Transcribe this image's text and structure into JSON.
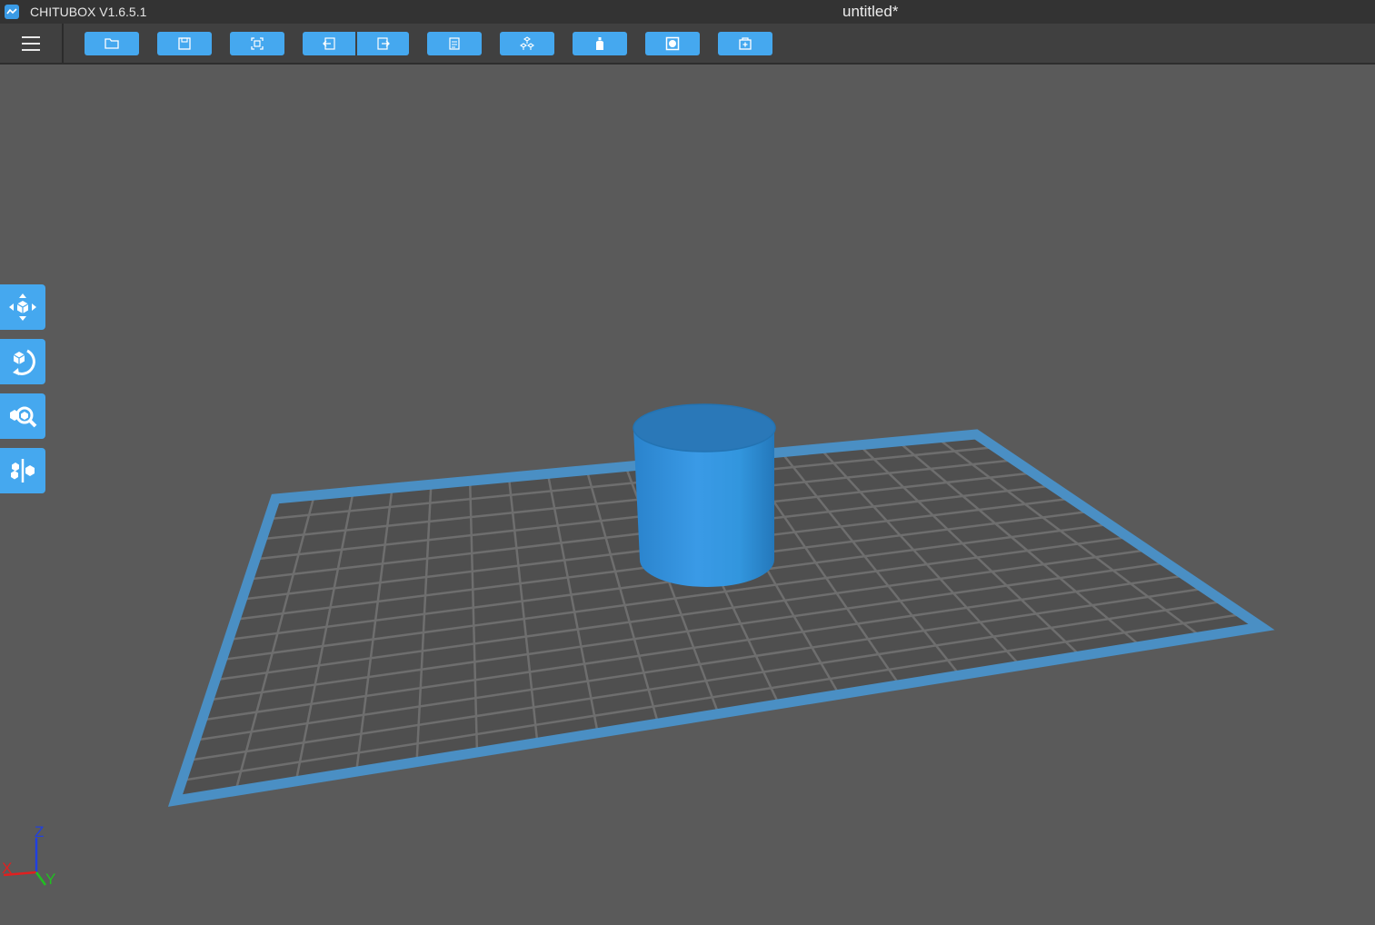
{
  "app": {
    "name": "CHITUBOX V1.6.5.1",
    "document_title": "untitled*",
    "logo_icon": "chitubox-logo-icon"
  },
  "toolbar": {
    "menu_icon": "hamburger-menu-icon",
    "buttons": [
      {
        "name": "open-file-button",
        "icon": "open-folder-icon"
      },
      {
        "name": "save-button",
        "icon": "save-icon"
      },
      {
        "name": "snapshot-button",
        "icon": "capture-icon"
      },
      {
        "name": "undo-button",
        "icon": "undo-arrow-icon"
      },
      {
        "name": "redo-button",
        "icon": "redo-arrow-icon"
      },
      {
        "name": "slice-list-button",
        "icon": "document-list-icon"
      },
      {
        "name": "auto-layout-button",
        "icon": "cubes-layout-icon"
      },
      {
        "name": "supports-button",
        "icon": "support-bottle-icon"
      },
      {
        "name": "hollow-button",
        "icon": "hollow-square-icon"
      },
      {
        "name": "add-plate-button",
        "icon": "add-box-icon"
      }
    ]
  },
  "side_tools": [
    {
      "name": "move-tool",
      "icon": "move-arrows-cube-icon"
    },
    {
      "name": "rotate-tool",
      "icon": "rotate-cube-icon"
    },
    {
      "name": "scale-tool",
      "icon": "scale-magnify-cube-icon"
    },
    {
      "name": "mirror-tool",
      "icon": "mirror-cubes-icon"
    }
  ],
  "scene": {
    "colors": {
      "background": "#5a5a5a",
      "plate_border": "#4a8fc4",
      "plate_fill": "#4f4f4f",
      "grid_lines": "#6e6e6e",
      "model": "#2f8fd8",
      "model_top": "#2a78b8"
    },
    "model_type": "cylinder"
  },
  "axes": {
    "x_label": "X",
    "y_label": "Y",
    "z_label": "Z",
    "x_color": "#e02020",
    "y_color": "#20c020",
    "z_color": "#2040e0"
  }
}
